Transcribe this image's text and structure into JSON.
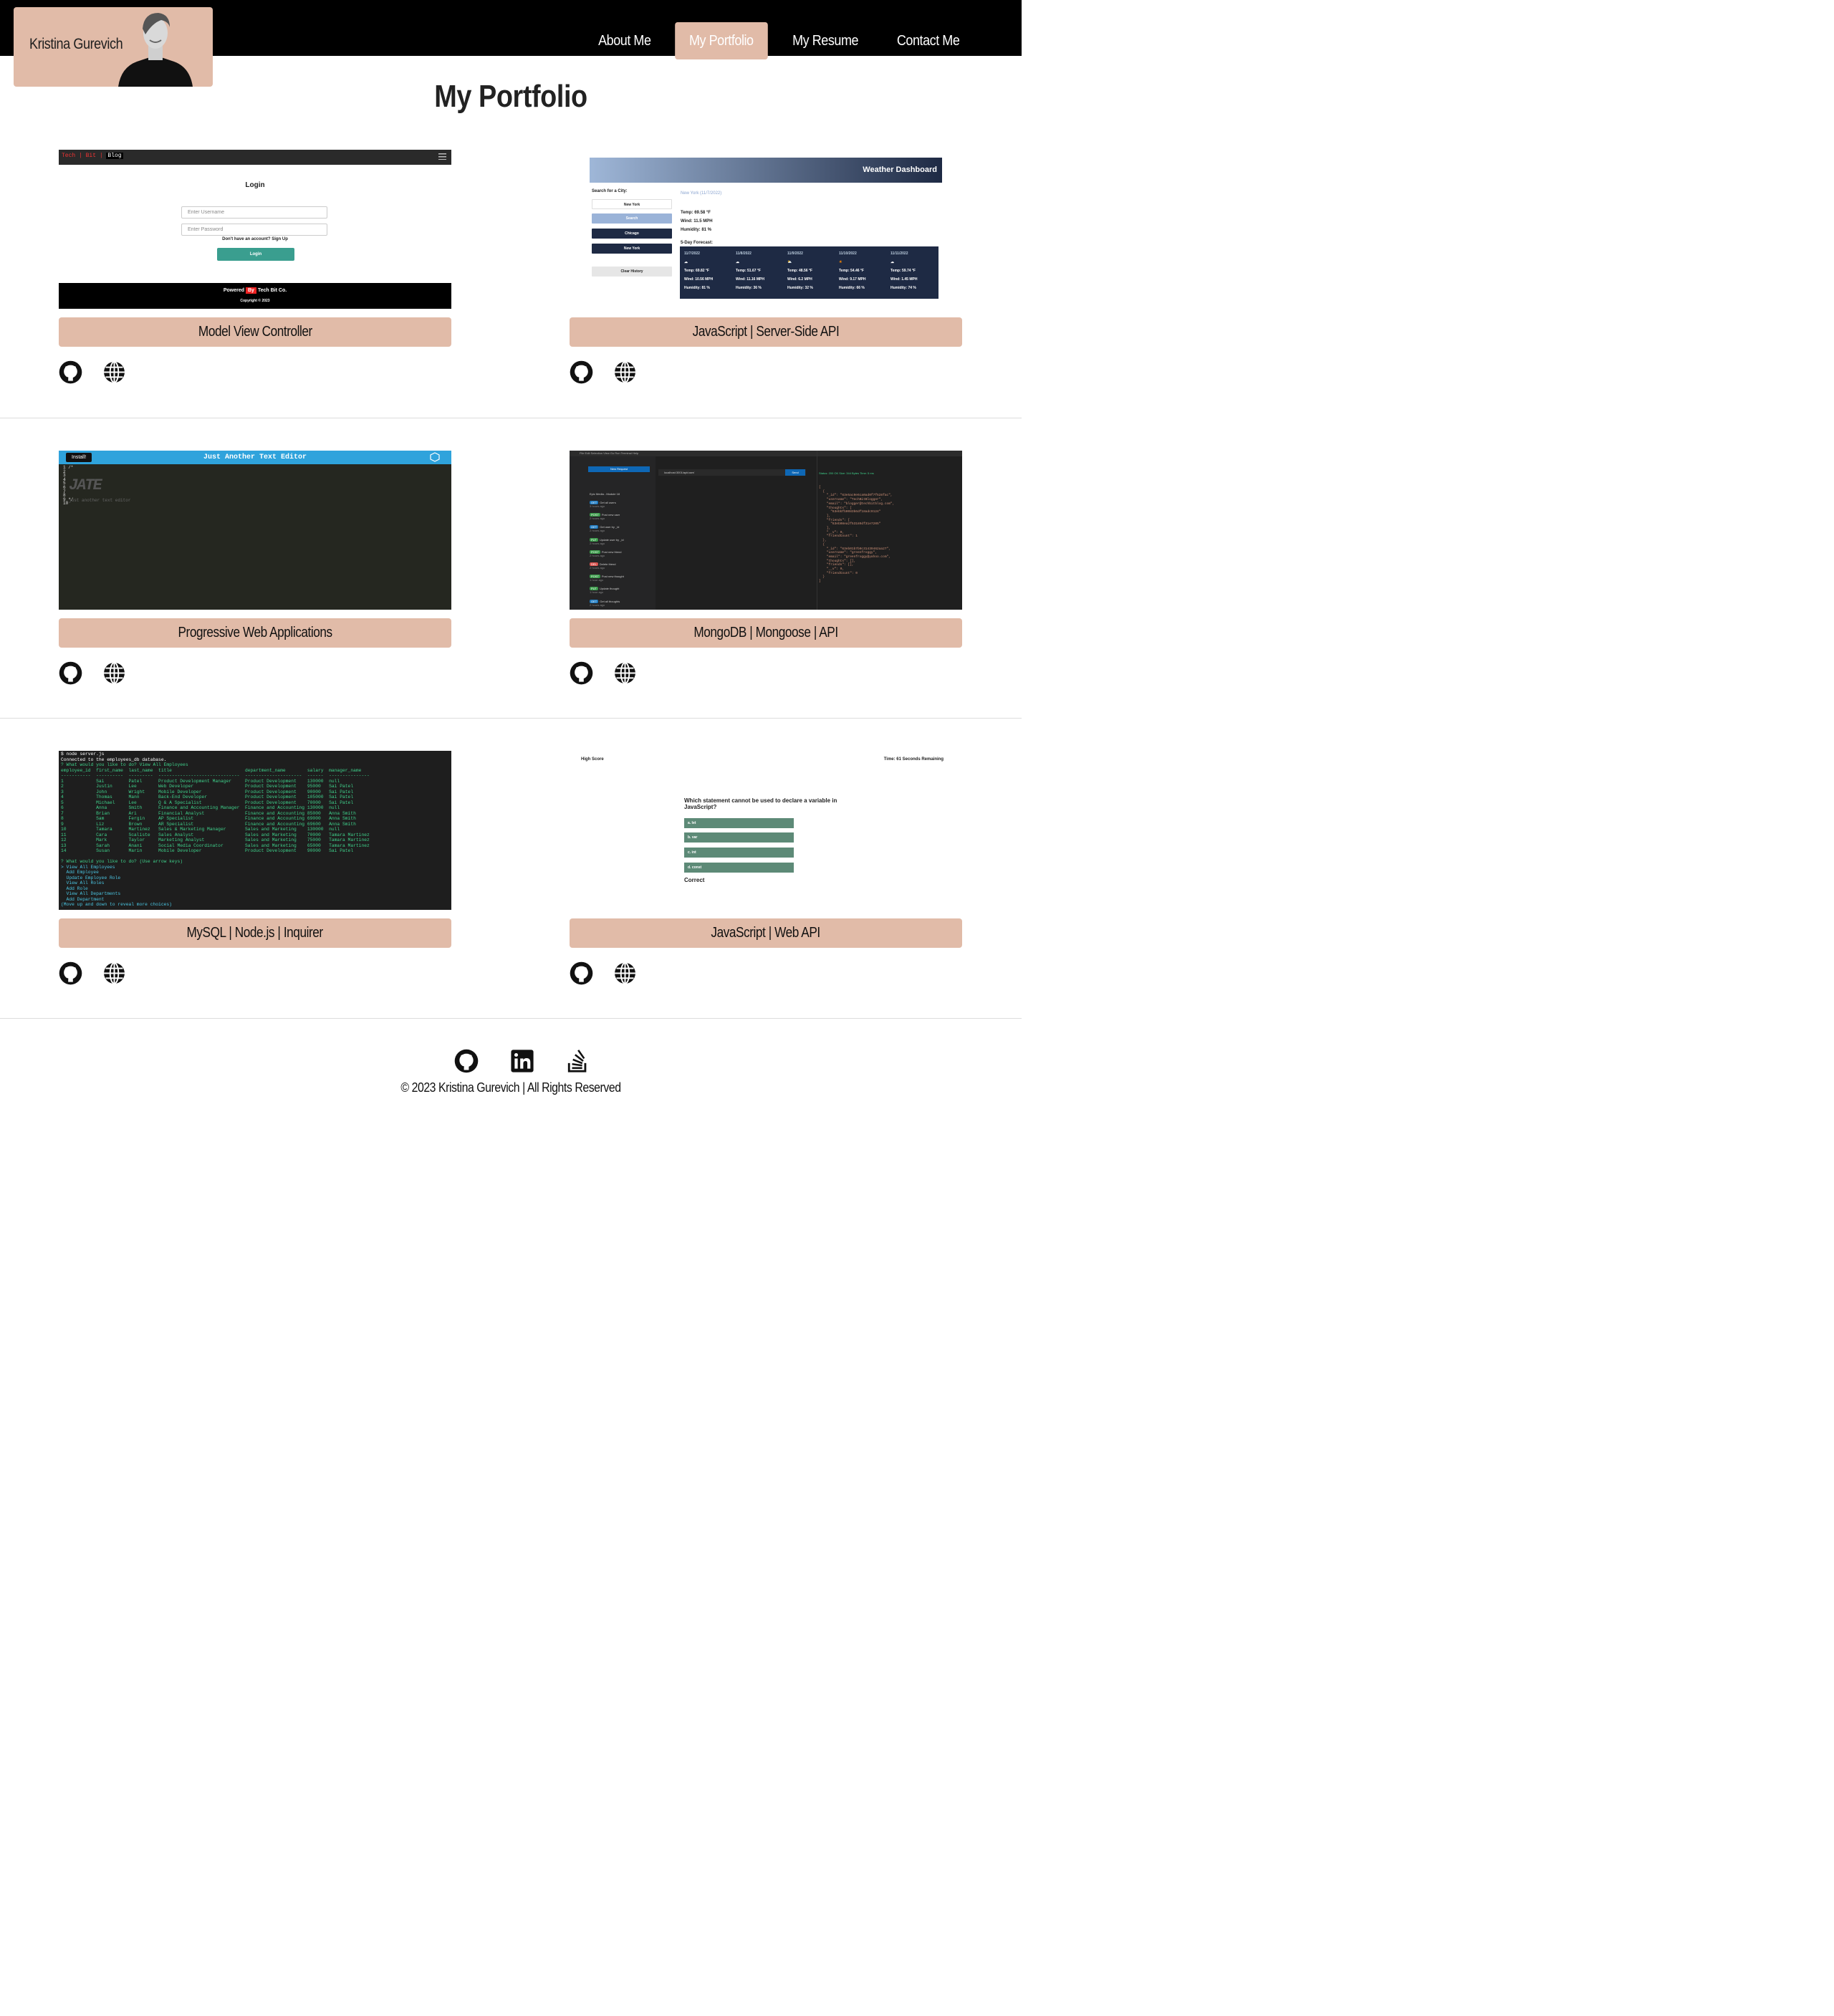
{
  "header": {
    "brand_name": "Kristina Gurevich",
    "nav": [
      "About Me",
      "My Portfolio",
      "My Resume",
      "Contact Me"
    ],
    "active_nav": "My Portfolio"
  },
  "page_title": "My Portfolio",
  "colors": {
    "accent": "#e1bba8",
    "header_bg": "#000000"
  },
  "projects": [
    {
      "label": "Model View Controller",
      "screenshot": {
        "logo": [
          "Tech",
          "Bit",
          "Blog"
        ],
        "title": "Login",
        "username_placeholder": "Enter Username",
        "password_placeholder": "Enter Password",
        "signup_text": "Don't have an account? Sign Up",
        "button": "Login",
        "powered": "Powered",
        "by": "By",
        "company": "Tech Bit Co.",
        "copyright": "Copyright © 2023"
      }
    },
    {
      "label": "JavaScript | Server-Side API",
      "screenshot": {
        "header": "Weather Dashboard",
        "search_label": "Search for a City:",
        "input_value": "New York",
        "search_button": "Search",
        "history": [
          "Chicago",
          "New York"
        ],
        "clear": "Clear History",
        "current_city": "New York (11/7/2022)",
        "temp": "Temp: 69.58 °F",
        "wind": "Wind: 11.5 MPH",
        "humidity": "Humidity: 81 %",
        "forecast_title": "5-Day Forecast:",
        "forecast": [
          {
            "date": "11/7/2022",
            "temp": "Temp: 69.82 °F",
            "wind": "Wind: 10.56 MPH",
            "humidity": "Humidity: 81 %"
          },
          {
            "date": "11/8/2022",
            "temp": "Temp: 51.67 °F",
            "wind": "Wind: 11.16 MPH",
            "humidity": "Humidity: 36 %"
          },
          {
            "date": "11/9/2022",
            "temp": "Temp: 48.56 °F",
            "wind": "Wind: 6.2 MPH",
            "humidity": "Humidity: 32 %"
          },
          {
            "date": "11/10/2022",
            "temp": "Temp: 54.46 °F",
            "wind": "Wind: 9.17 MPH",
            "humidity": "Humidity: 66 %"
          },
          {
            "date": "11/11/2022",
            "temp": "Temp: 59.74 °F",
            "wind": "Wind: 1.45 MPH",
            "humidity": "Humidity: 74 %"
          }
        ]
      }
    },
    {
      "label": "Progressive Web Applications",
      "screenshot": {
        "install": "Install!",
        "header": "Just Another Text Editor",
        "art": "JATE",
        "subtitle": "just another text editor"
      }
    },
    {
      "label": "MongoDB | Mongoose | API",
      "screenshot": {
        "menu": "File   Edit   Selection   View   Go   Run   Terminal   Help",
        "new_request": "New Request",
        "collection": "Epic Media - Module 18",
        "requests": [
          {
            "method": "GET",
            "name": "Get all users",
            "time": "3 hours ago"
          },
          {
            "method": "POST",
            "name": "Post new user",
            "time": "2 hours ago"
          },
          {
            "method": "GET",
            "name": "Get user by _id",
            "time": "2 hours ago"
          },
          {
            "method": "PUT",
            "name": "Update user by _id",
            "time": "2 hours ago"
          },
          {
            "method": "POST",
            "name": "Post new friend",
            "time": "2 hours ago"
          },
          {
            "method": "DEL",
            "name": "Delete friend",
            "time": "2 hours ago"
          },
          {
            "method": "POST",
            "name": "Post new thought",
            "time": "1 hour ago"
          },
          {
            "method": "PUT",
            "name": "Update thought",
            "time": "1 hour ago"
          },
          {
            "method": "GET",
            "name": "Get all thoughts",
            "time": "2 hours ago"
          }
        ],
        "url": "localhost:3001/api/user/",
        "send": "Send",
        "status": "Status: 200 OK    Size: 344 Bytes    Time: 5 ms",
        "json": "[\n  {\n    \"_id\": \"63e5ac0e6ca0ad0f7f528fac\",\n    \"username\": \"TechBitBlogger\",\n    \"email\": \"blogger@techbitblog.com\",\n    \"thoughts\": [\n      \"63ebbfb0083b6df18adc9124\"\n    ],\n    \"friends\": [\n      \"63eb08ea2f53189df31e7205\"\n    ],\n    \"__v\": 0,\n    \"friendCount\": 1\n  },\n  {\n    \"_id\": \"63eb01b7b0c31439462aa27\",\n    \"username\": \"greenfroggy\",\n    \"email\": \"greenfroggy@yahoo.com\",\n    \"thoughts\": [],\n    \"friends\": [],\n    \"__v\": 0,\n    \"friendCount\": 0\n  }\n]"
      }
    },
    {
      "label": "MySQL | Node.js | Inquirer",
      "screenshot": {
        "cmd": "$ node server.js",
        "connected": "Connected to the employees_db database.",
        "prompt": "? What would you like to do? View All Employees",
        "table": "employee_id  first_name  last_name  title                           department_name        salary  manager_name\n-----------  ----------  ---------  ------------------------------  ---------------------  ------  ---------------\n1            Sai         Patel      Product Development Manager     Product Development    130000  null\n2            Justin      Lee        Web Developer                   Product Development    95000   Sai Patel\n3            John        Wright     Mobile Developer                Product Development    90000   Sai Patel\n4            Thomas      Mann       Back-End Developer              Product Development    105000  Sai Patel\n5            Michael     Lee        Q & A Specialist                Product Development    70000   Sai Patel\n6            Anna        Smith      Finance and Accounting Manager  Finance and Accounting 130000  null\n7            Brian       Ari        Financial Analyst               Finance and Accounting 85000   Anna Smith\n8            Sam         Fergin     AP Specialist                   Finance and Accounting 69000   Anna Smith\n9            Liz         Brown      AR Specialist                   Finance and Accounting 69600   Anna Smith\n10           Tamara      Martinez   Sales & Marketing Manager       Sales and Marketing    130000  null\n11           Cara        Scaliste   Sales Analyst                   Sales and Marketing    70000   Tamara Martinez\n12           Mark        Taylor     Marketing Analyst               Sales and Marketing    75000   Tamara Martinez\n13           Sarah       Anani      Social Media Coordinator        Sales and Marketing    65000   Tamara Martinez\n14           Susan       Marin      Mobile Developer                Product Development    90000   Sai Patel",
        "prompt2": "? What would you like to do? (Use arrow keys)",
        "choices": "> View All Employees\n  Add Employee\n  Update Employee Role\n  View All Roles\n  Add Role\n  View All Departments\n  Add Department\n(Move up and down to reveal more choices)"
      }
    },
    {
      "label": "JavaScript | Web API",
      "screenshot": {
        "high_score": "High Score",
        "timer": "Time: 61 Seconds Remaining",
        "question": "Which statement cannot be used to declare a variable in JavaScript?",
        "options": [
          "a. let",
          "b. var",
          "c. int",
          "d. const"
        ],
        "result": "Correct"
      }
    }
  ],
  "footer": {
    "icons": [
      "github-icon",
      "linkedin-icon",
      "stackoverflow-icon"
    ],
    "copyright": "© 2023 Kristina Gurevich | All Rights Reserved"
  }
}
